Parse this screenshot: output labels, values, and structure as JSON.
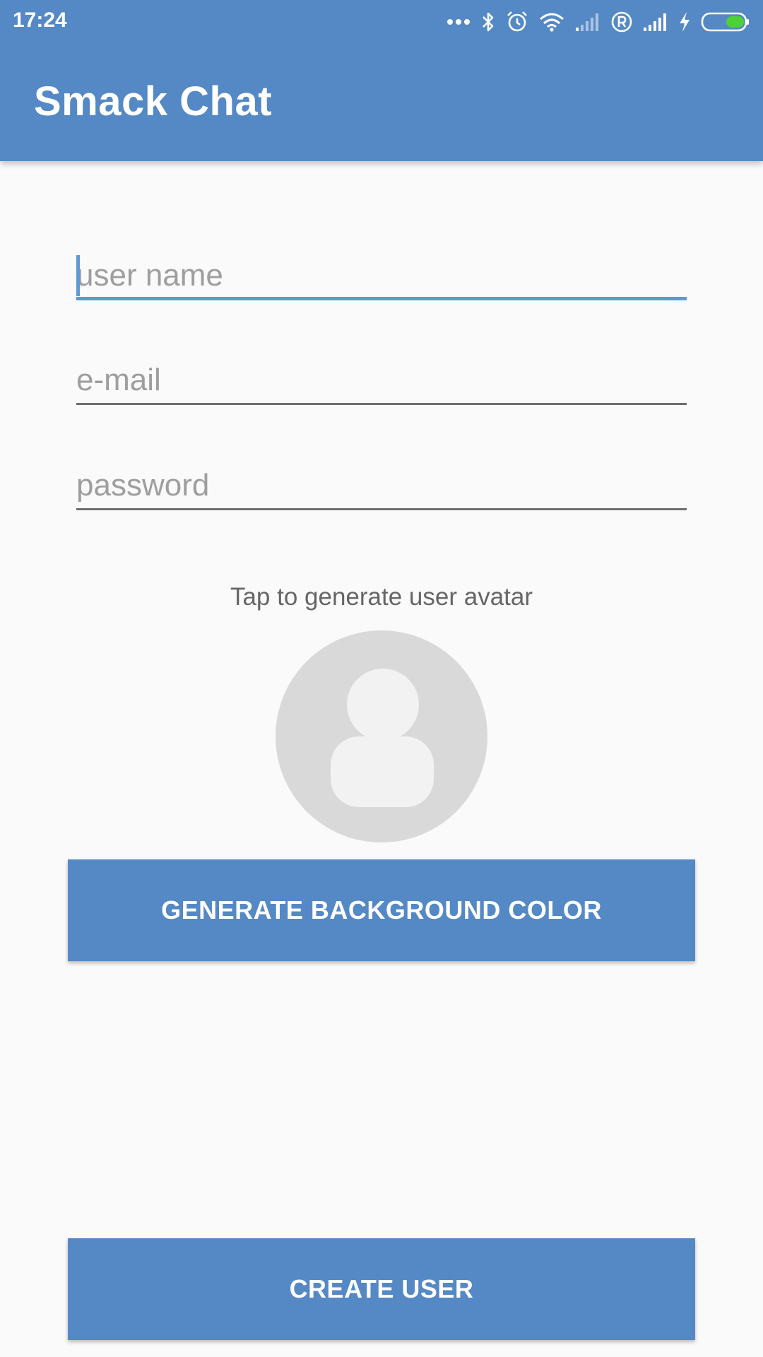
{
  "status_bar": {
    "time": "17:24",
    "icons": [
      "more-dots-icon",
      "bluetooth-icon",
      "alarm-icon",
      "wifi-icon",
      "signal-weak-icon",
      "registered-icon",
      "signal-strong-icon",
      "charging-bolt-icon",
      "battery-icon"
    ]
  },
  "app_bar": {
    "title": "Smack Chat"
  },
  "form": {
    "username_placeholder": "user name",
    "username_value": "",
    "email_placeholder": "e-mail",
    "email_value": "",
    "password_placeholder": "password",
    "password_value": ""
  },
  "avatar": {
    "hint": "Tap to generate user avatar",
    "icon": "user-silhouette-icon"
  },
  "buttons": {
    "generate_bg": "GENERATE BACKGROUND COLOR",
    "create_user": "CREATE USER"
  },
  "colors": {
    "primary": "#5589C5",
    "accent": "#5C9BD1",
    "background": "#FAFAFA",
    "battery_level": "#4CD137"
  }
}
